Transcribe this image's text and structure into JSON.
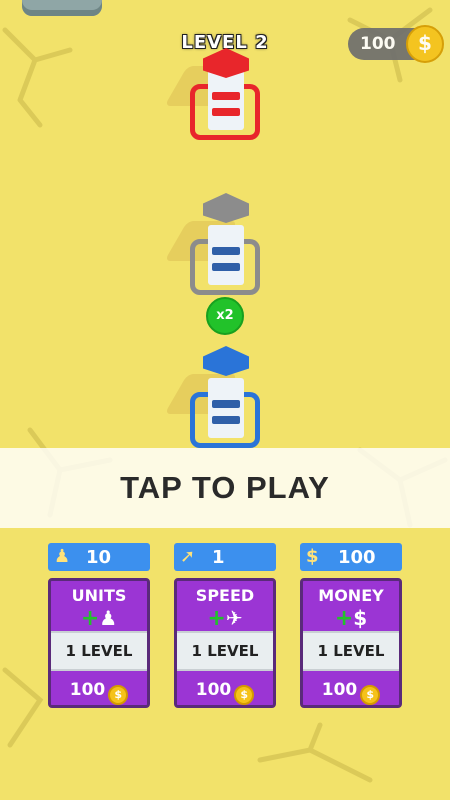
{
  "hud": {
    "level_label": "LEVEL 2",
    "coins": "100",
    "coin_symbol": "$"
  },
  "board": {
    "multiplier": "x2",
    "towers": [
      {
        "team": "enemy",
        "color": "#e8262b"
      },
      {
        "team": "neutral",
        "color": "#8c8c8c"
      },
      {
        "team": "player",
        "color": "#2a74d8"
      }
    ]
  },
  "banner": {
    "text": "TAP TO PLAY"
  },
  "upgrades": [
    {
      "stat_icon": "person-icon",
      "stat_value": "10",
      "title": "UNITS",
      "plus_glyph": "+",
      "sub_glyph": "♟",
      "level": "1 LEVEL",
      "cost": "100"
    },
    {
      "stat_icon": "runner-icon",
      "stat_value": "1",
      "title": "SPEED",
      "plus_glyph": "+",
      "sub_glyph": "✈",
      "level": "1 LEVEL",
      "cost": "100"
    },
    {
      "stat_icon": "dollar-icon",
      "stat_value": "100",
      "title": "MONEY",
      "plus_glyph": "+",
      "sub_glyph": "$",
      "level": "1 LEVEL",
      "cost": "100"
    }
  ],
  "colors": {
    "background": "#f2e26a",
    "card": "#9b35d4",
    "stat_bar": "#3c90ee",
    "coin": "#f5c21a"
  }
}
